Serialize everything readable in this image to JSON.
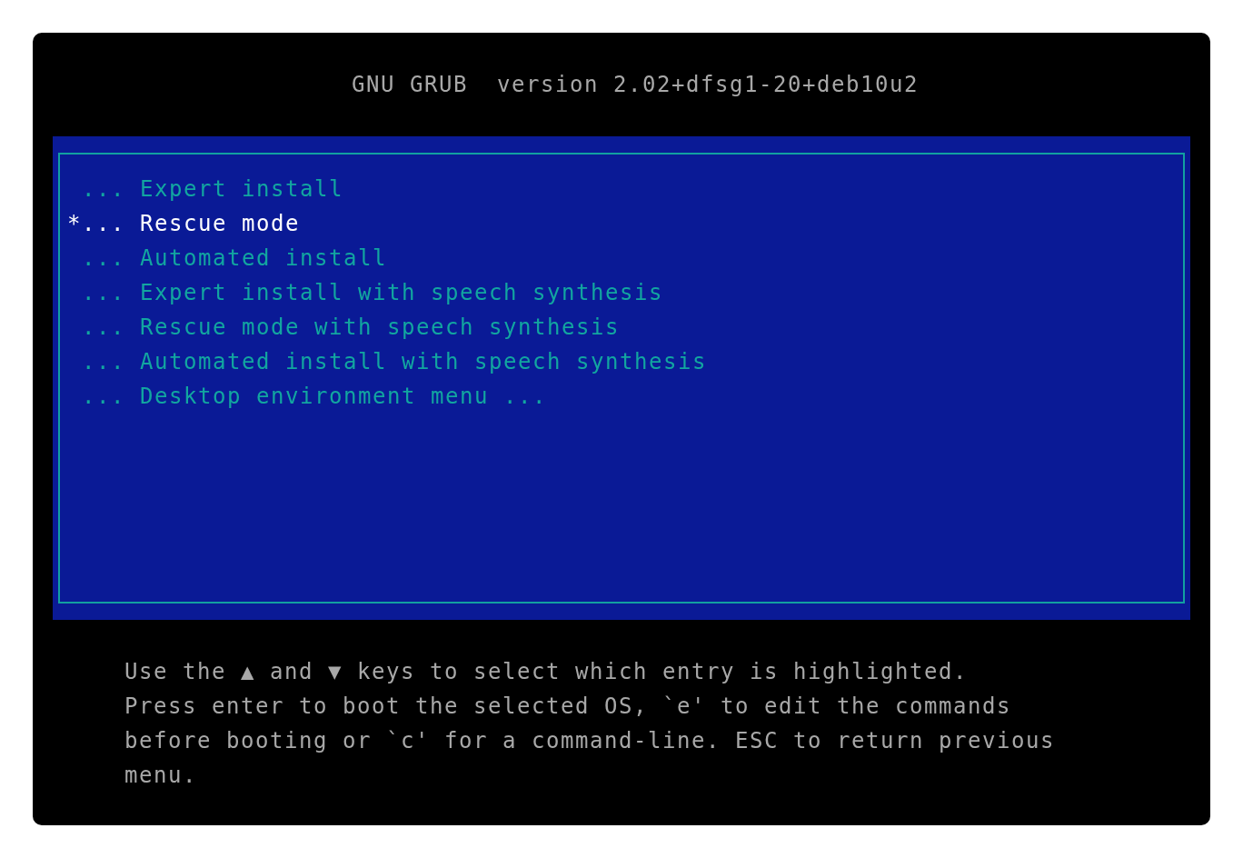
{
  "title": "GNU GRUB  version 2.02+dfsg1-20+deb10u2",
  "menu": {
    "selected_marker": "*",
    "entries": [
      {
        "label": "... Expert install",
        "selected": false
      },
      {
        "label": "... Rescue mode",
        "selected": true
      },
      {
        "label": "... Automated install",
        "selected": false
      },
      {
        "label": "... Expert install with speech synthesis",
        "selected": false
      },
      {
        "label": "... Rescue mode with speech synthesis",
        "selected": false
      },
      {
        "label": "... Automated install with speech synthesis",
        "selected": false
      },
      {
        "label": "... Desktop environment menu ...",
        "selected": false
      }
    ]
  },
  "help_lines": [
    "Use the ▲ and ▼ keys to select which entry is highlighted.",
    "Press enter to boot the selected OS, `e' to edit the commands",
    "before booting or `c' for a command-line. ESC to return previous",
    "menu."
  ]
}
